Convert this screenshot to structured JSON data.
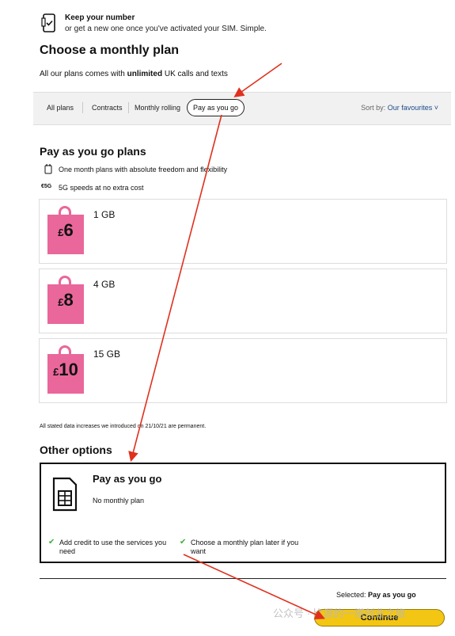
{
  "keep_number": {
    "title": "Keep your number",
    "subtitle": "or get a new one once you've activated your SIM. Simple."
  },
  "choose": {
    "heading": "Choose a monthly plan",
    "note_prefix": "All our plans comes with ",
    "note_bold": "unlimited",
    "note_suffix": " UK calls and texts"
  },
  "filter": {
    "tabs": [
      "All plans",
      "Contracts",
      "Monthly rolling",
      "Pay as you go"
    ],
    "active_tab": "Pay as you go",
    "sort_label": "Sort by:",
    "sort_value": "Our favourites"
  },
  "payg": {
    "heading": "Pay as you go plans",
    "feature1": "One month plans with absolute freedom and flexibility",
    "feature2_icon_text": "€5G",
    "feature2": "5G speeds at no extra cost",
    "plans": [
      {
        "currency": "£",
        "price": "6",
        "data": "1 GB"
      },
      {
        "currency": "£",
        "price": "8",
        "data": "4 GB"
      },
      {
        "currency": "£",
        "price": "10",
        "data": "15 GB"
      }
    ]
  },
  "stated": "All stated data increases we introduced on 21/10/21 are permanent.",
  "other": {
    "heading": "Other options",
    "card_title": "Pay as you go",
    "card_sub": "No monthly plan",
    "check1": "Add credit to use the services you need",
    "check2": "Choose a monthly plan later if you want"
  },
  "footer": {
    "selected_label": "Selected:",
    "selected_value": "Pay as you go",
    "continue_label": "Continue"
  },
  "watermark": "公众号 · 比源的一搭创业之旅",
  "colors": {
    "bag_pink": "#e9679a",
    "continue_yellow": "#f2c613",
    "annotation_red": "#e0301e",
    "check_green": "#3cae3c",
    "link_blue": "#1a4a8a"
  }
}
